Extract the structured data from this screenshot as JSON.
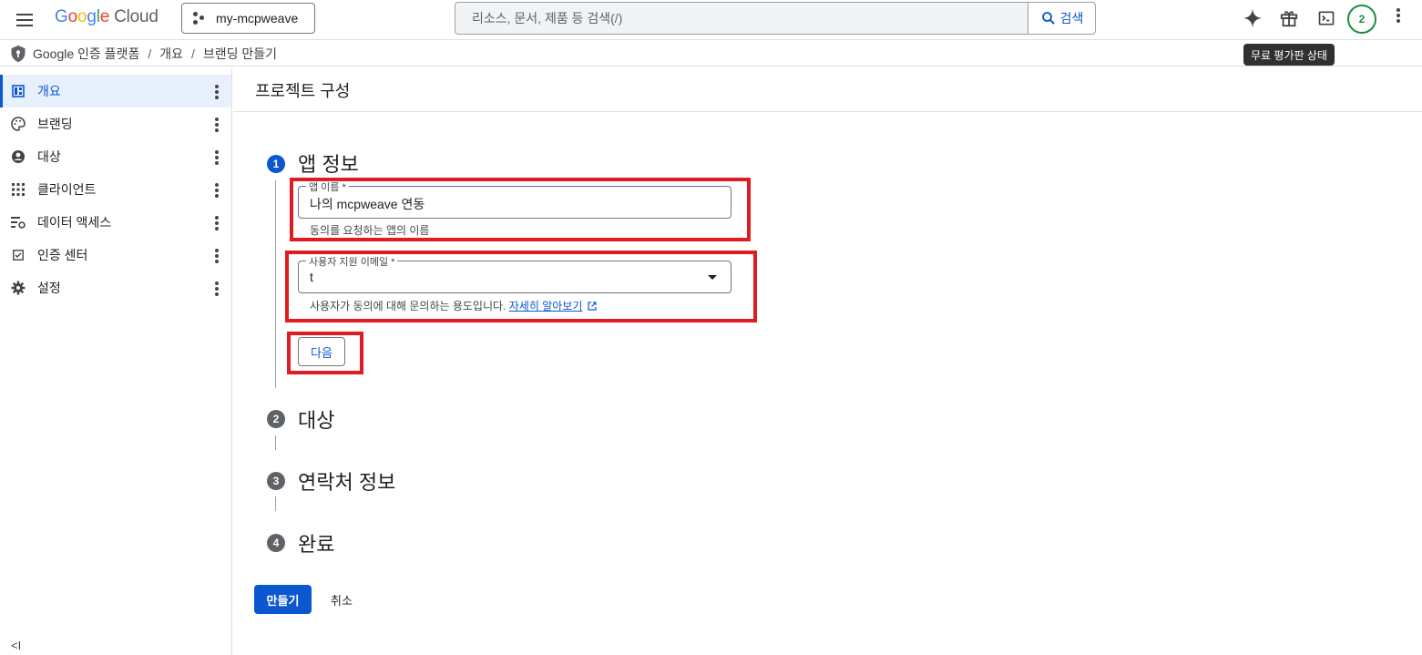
{
  "header": {
    "logo_word": "Google",
    "logo_suffix": "Cloud",
    "project": "my-mcpweave",
    "search_placeholder": "리소스, 문서, 제품 등 검색(/)",
    "search_button": "검색",
    "avatar_badge": "2",
    "tooltip": "무료 평가판 상태"
  },
  "breadcrumbs": [
    "Google 인증 플랫폼",
    "개요",
    "브랜딩 만들기"
  ],
  "sidebar": {
    "items": [
      {
        "label": "개요",
        "icon": "dashboard-icon",
        "active": true
      },
      {
        "label": "브랜딩",
        "icon": "palette-icon"
      },
      {
        "label": "대상",
        "icon": "account-circle-icon"
      },
      {
        "label": "클라이언트",
        "icon": "apps-grid-icon"
      },
      {
        "label": "데이터 액세스",
        "icon": "data-access-icon"
      },
      {
        "label": "인증 센터",
        "icon": "checkbox-icon"
      },
      {
        "label": "설정",
        "icon": "gear-icon"
      }
    ],
    "collapse_glyph": "<I"
  },
  "main": {
    "title": "프로젝트 구성",
    "steps": [
      {
        "number": "1",
        "title": "앱 정보"
      },
      {
        "number": "2",
        "title": "대상"
      },
      {
        "number": "3",
        "title": "연락처 정보"
      },
      {
        "number": "4",
        "title": "완료"
      }
    ],
    "app_name": {
      "label": "앱 이름 *",
      "value": "나의 mcpweave 연동",
      "helper": "동의를 요청하는 앱의 이름"
    },
    "support_email": {
      "label": "사용자 지원 이메일 *",
      "value": "t",
      "helper": "사용자가 동의에 대해 문의하는 용도입니다.",
      "link": "자세히 알아보기"
    },
    "next_button": "다음",
    "create_button": "만들기",
    "cancel_button": "취소"
  },
  "colors": {
    "accent": "#0b57d0",
    "highlight_box": "#e01b22",
    "avatar_ring": "#1e8e3e"
  }
}
